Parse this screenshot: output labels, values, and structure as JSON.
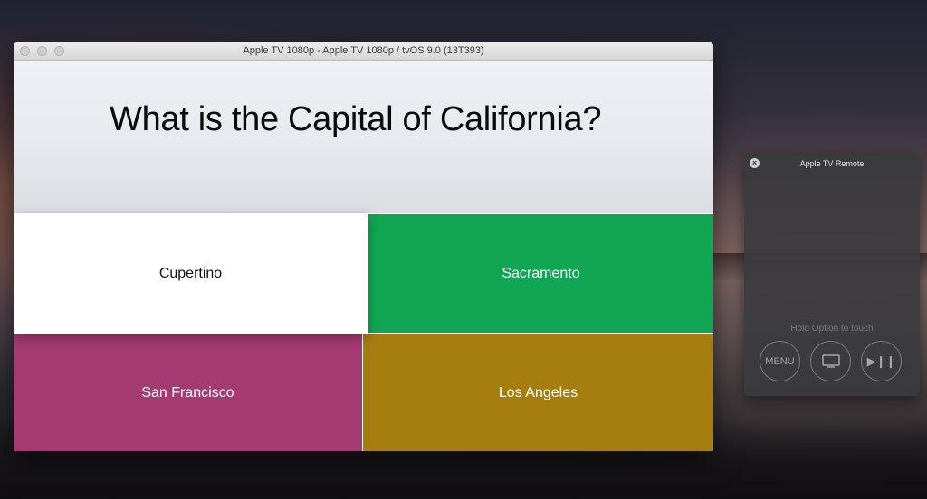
{
  "window": {
    "title": "Apple TV 1080p - Apple TV 1080p / tvOS 9.0 (13T393)"
  },
  "quiz": {
    "question": "What is the Capital of California?",
    "answers": [
      {
        "label": "Cupertino",
        "color": "#ffffff",
        "focused": true
      },
      {
        "label": "Sacramento",
        "color": "#10a653"
      },
      {
        "label": "San Francisco",
        "color": "#a43b72"
      },
      {
        "label": "Los Angeles",
        "color": "#a67e10"
      }
    ]
  },
  "remote": {
    "title": "Apple TV Remote",
    "hint": "Hold Option to touch",
    "close_icon": "×",
    "menu_label": "MENU",
    "tv_icon": "tv-icon",
    "play_pause_glyph": "▶❙❙"
  }
}
